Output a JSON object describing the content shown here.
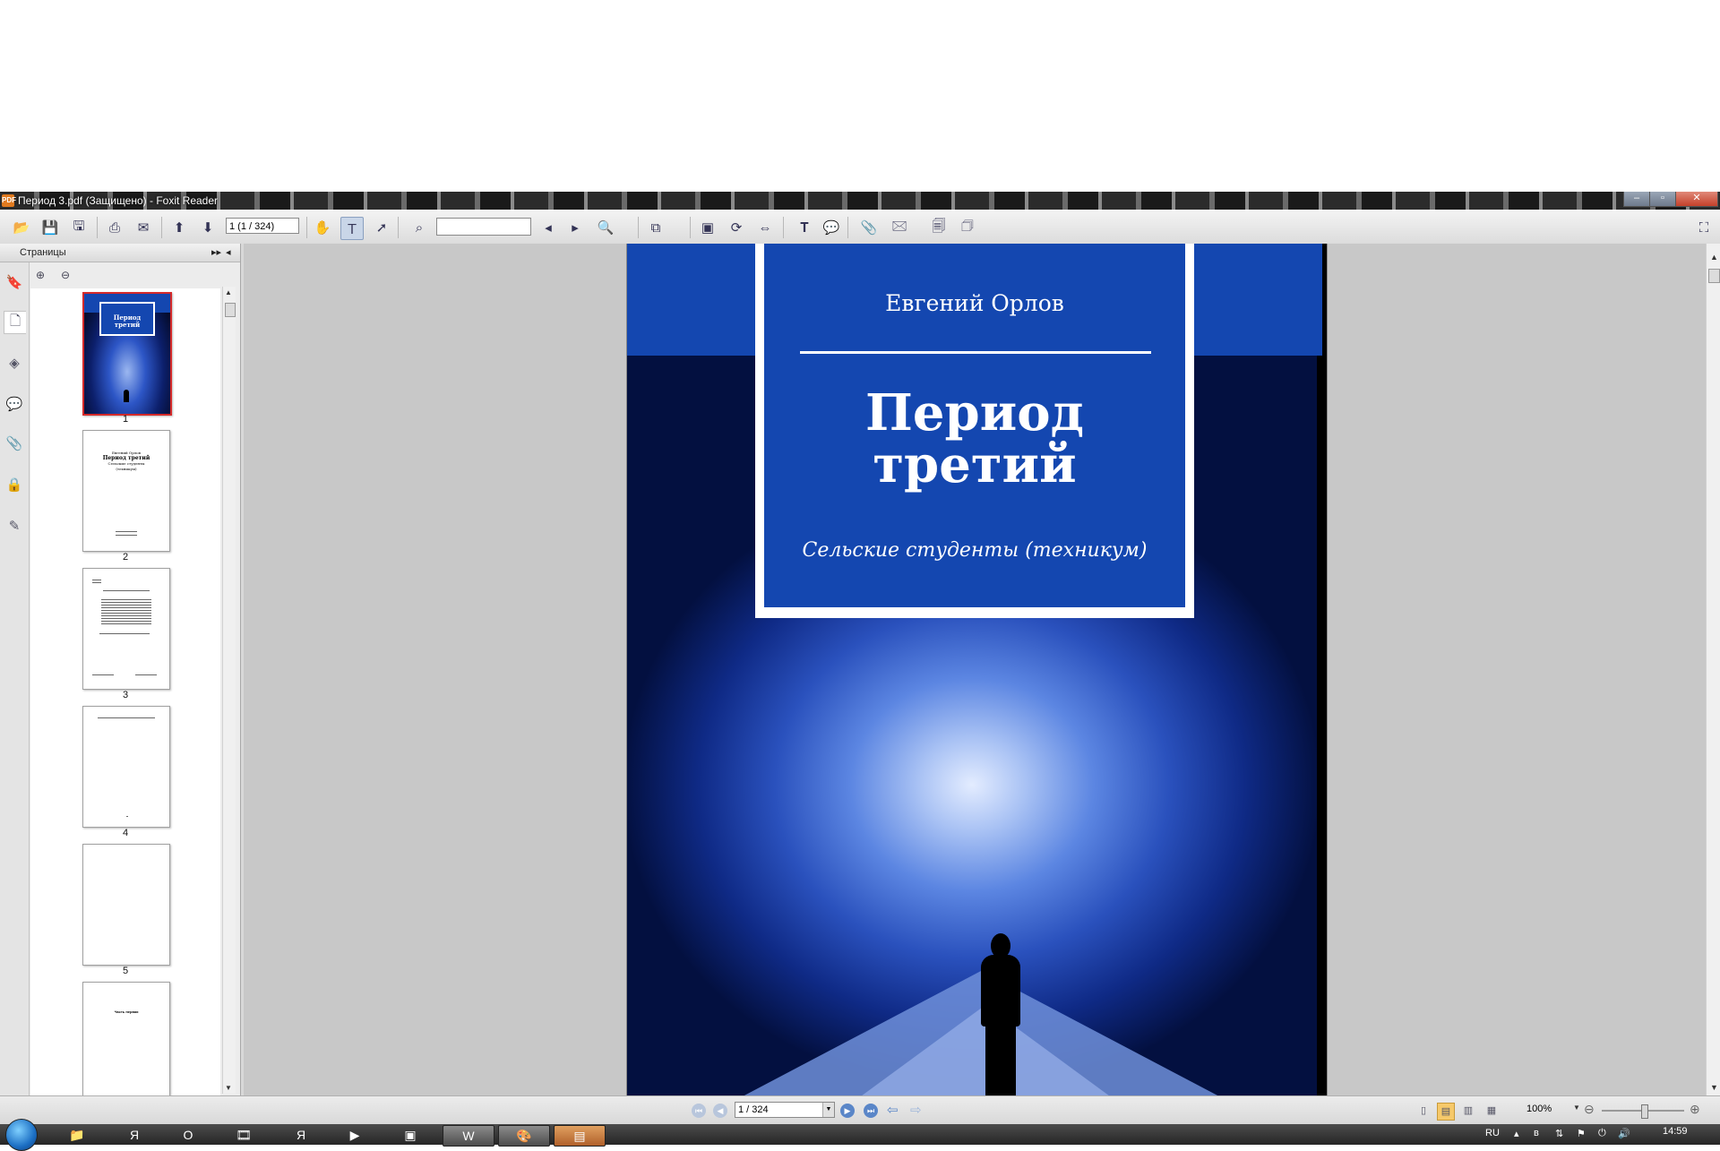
{
  "window": {
    "title": "Период 3.pdf (Защищено) - Foxit Reader",
    "app_icon": "PDF",
    "controls": {
      "minimize": "–",
      "maximize": "▫",
      "close": "✕"
    }
  },
  "toolbar": {
    "page_field": "1 (1 / 324)",
    "search_placeholder": ""
  },
  "sidebar": {
    "header": "Страницы",
    "expand_icon": "▸▸",
    "collapse_icon": "◂",
    "thumbnails": [
      {
        "number": "1",
        "selected": true,
        "cover_title": "Период третий"
      },
      {
        "number": "2",
        "title_lines": [
          "Евгений Орлов",
          "Период третий",
          "Сельские студенты",
          "(техникум)"
        ]
      },
      {
        "number": "3"
      },
      {
        "number": "4"
      },
      {
        "number": "5"
      },
      {
        "number": "",
        "text": "Часть первая"
      }
    ]
  },
  "document": {
    "author": "Евгений Орлов",
    "title_line1": "Период",
    "title_line2": "третий",
    "subtitle": "Сельские студенты (техникум)"
  },
  "statusbar": {
    "page_nav": "1 / 324",
    "zoom": "100%"
  },
  "taskbar": {
    "language": "RU",
    "time": "14:59"
  },
  "colors": {
    "cover_blue": "#1447b0",
    "accent_orange": "#e07a1f"
  }
}
